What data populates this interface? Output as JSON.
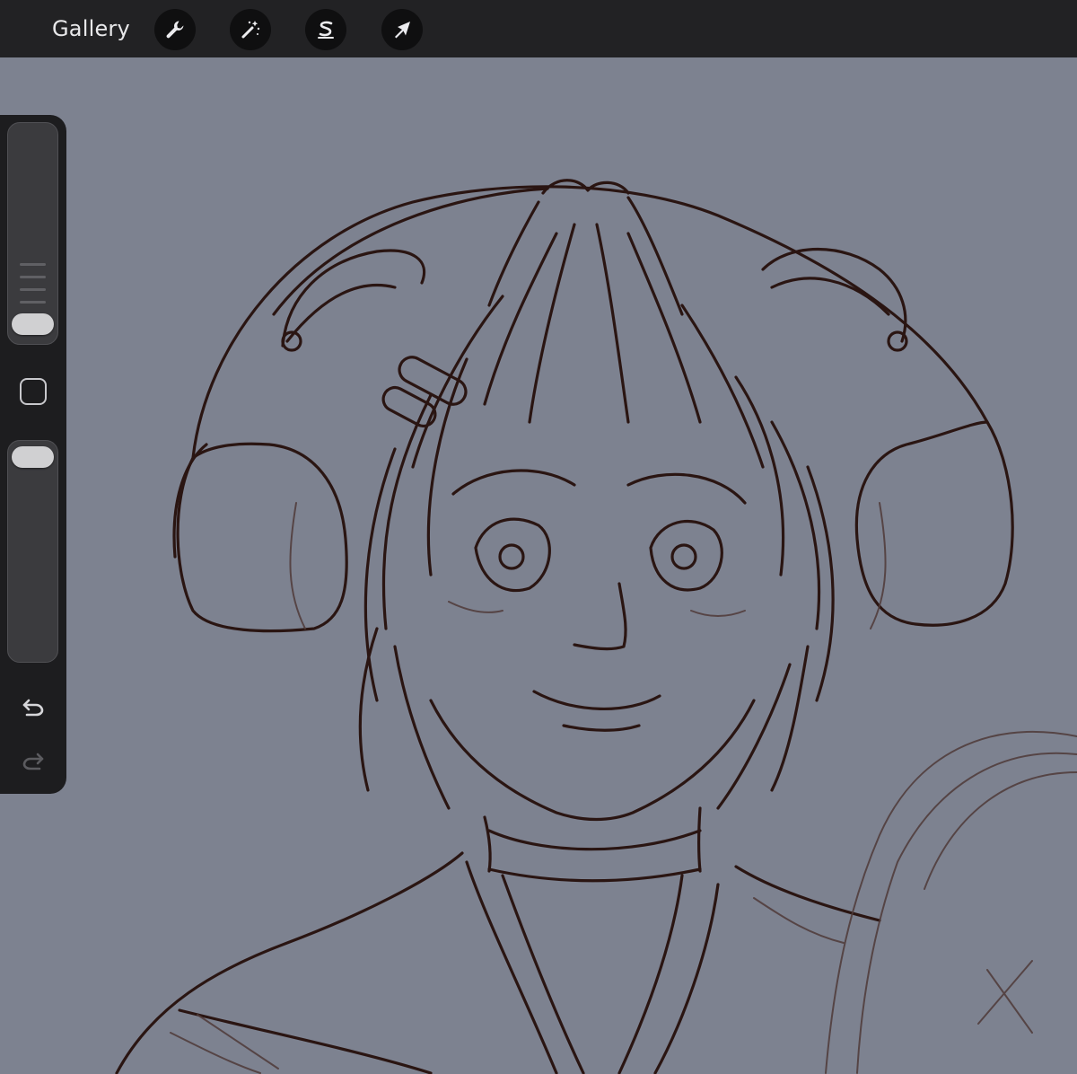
{
  "topbar": {
    "gallery_label": "Gallery",
    "tools": [
      {
        "name": "actions",
        "icon": "wrench-icon"
      },
      {
        "name": "adjustments",
        "icon": "magic-wand-icon"
      },
      {
        "name": "selection",
        "icon": "selection-s-icon"
      },
      {
        "name": "transform",
        "icon": "arrow-cursor-icon"
      }
    ]
  },
  "sidebar": {
    "brush_size_level": 0.07,
    "opacity_level": 1.0,
    "modify_button_icon": "square-icon",
    "undo_icon": "undo-icon",
    "redo_icon": "redo-icon"
  },
  "colors": {
    "toolbar_bg": "#222224",
    "canvas_bg": "#7d8290",
    "sidebar_bg": "#1d1d1f",
    "line_art": "#2a1512"
  }
}
